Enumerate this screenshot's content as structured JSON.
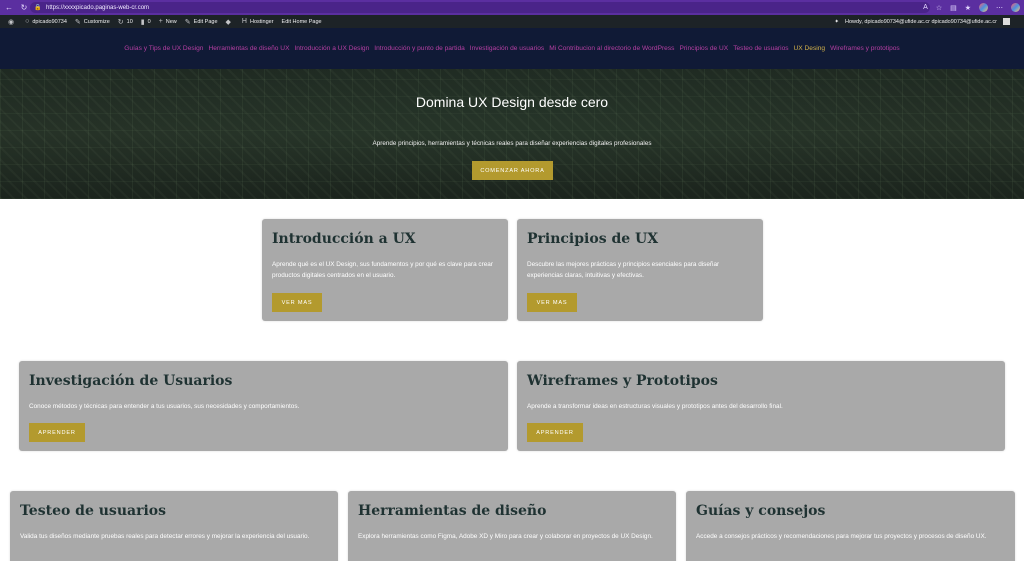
{
  "browser": {
    "url": "https://xxxxpicado.paginas-web-cr.com",
    "back_icon": "arrow-left",
    "reload_icon": "reload"
  },
  "admin_bar": {
    "site_name": "dpicado90734",
    "customize": "Customize",
    "updates": "10",
    "comments": "0",
    "new": "New",
    "edit_page": "Edit Page",
    "hostinger": "Hostinger",
    "edit_home": "Edit Home Page",
    "howdy": "Howdy, dpicado90734@ufide.ac.cr dpicado90734@ufide.ac.cr"
  },
  "menu": [
    "Guías y Tips de UX Design",
    "Herramientas de diseño UX",
    "Introducción a UX Design",
    "Introducción y punto de partida",
    "Investigación de usuarios",
    "Mi Contribucion al directorio de WordPress",
    "Principios de UX",
    "Testeo de usuarios",
    "UX Desing",
    "Wireframes y prototipos"
  ],
  "menu_active_index": 8,
  "hero": {
    "title": "Domina UX Design desde cero",
    "subtitle": "Aprende principios, herramientas y técnicas reales para diseñar experiencias digitales profesionales",
    "button": "COMENZAR AHORA"
  },
  "cards": [
    {
      "title": "Introducción a UX",
      "description": "Aprende qué es el UX Design, sus fundamentos y por qué es clave para crear productos digitales centrados en el usuario.",
      "button": "VER MAS"
    },
    {
      "title": "Principios de UX",
      "description": "Descubre las mejores prácticas y principios esenciales para diseñar experiencias claras, intuitivas y efectivas.",
      "button": "VER MAS"
    },
    {
      "title": "Investigación de Usuarios",
      "description": "Conoce métodos y técnicas para entender a tus usuarios, sus necesidades y comportamientos.",
      "button": "APRENDER"
    },
    {
      "title": "Wireframes y Prototipos",
      "description": "Aprende a transformar ideas en estructuras visuales y prototipos antes del desarrollo final.",
      "button": "APRENDER"
    },
    {
      "title": "Testeo de usuarios",
      "description": "Valida tus diseños mediante pruebas reales para detectar errores y mejorar la experiencia del usuario."
    },
    {
      "title": "Herramientas de diseño",
      "description": "Explora herramientas como Figma, Adobe XD y Miro para crear y colaborar en proyectos de UX Design."
    },
    {
      "title": "Guías y consejos",
      "description": "Accede a consejos prácticos y recomendaciones para mejorar tus proyectos y procesos de diseño UX."
    }
  ],
  "colors": {
    "header_bg": "#101a36",
    "menu_link": "#b63fa3",
    "menu_active": "#d4b24a",
    "button_gold": "#b39a2e",
    "card_bg": "#a9a9a9",
    "card_title": "#1f3232"
  }
}
